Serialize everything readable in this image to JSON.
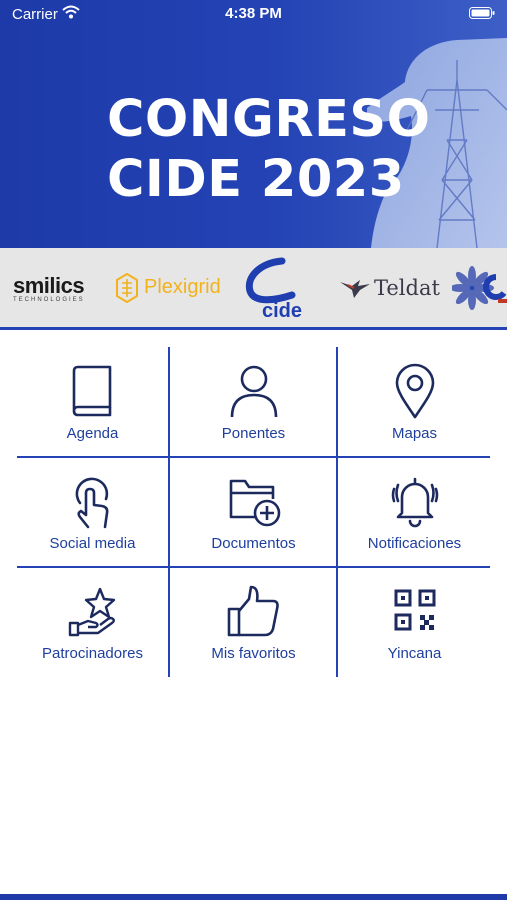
{
  "status_bar": {
    "carrier": "Carrier",
    "time": "4:38 PM"
  },
  "hero": {
    "title_line1": "CONGRESO",
    "title_line2": "CIDE 2023"
  },
  "sponsors": {
    "smilics": {
      "name": "smilics",
      "sub": "TECHNOLOGIES"
    },
    "plexigrid": {
      "name": "Plexigrid"
    },
    "cide": {
      "name": "cide"
    },
    "teldat": {
      "name": "Teldat"
    }
  },
  "menu": {
    "items": [
      {
        "label": "Agenda",
        "icon": "book-icon"
      },
      {
        "label": "Ponentes",
        "icon": "person-icon"
      },
      {
        "label": "Mapas",
        "icon": "map-pin-icon"
      },
      {
        "label": "Social media",
        "icon": "touch-icon"
      },
      {
        "label": "Documentos",
        "icon": "folder-add-icon"
      },
      {
        "label": "Notificaciones",
        "icon": "bell-icon"
      },
      {
        "label": "Patrocinadores",
        "icon": "sponsor-star-icon"
      },
      {
        "label": "Mis favoritos",
        "icon": "thumbs-up-icon"
      },
      {
        "label": "Yincana",
        "icon": "qr-code-icon"
      }
    ]
  },
  "colors": {
    "brand_blue": "#2443b5",
    "label_blue": "#1f3f9e",
    "icon_navy": "#1c2a5e",
    "plexigrid_yellow": "#f2b21c"
  }
}
